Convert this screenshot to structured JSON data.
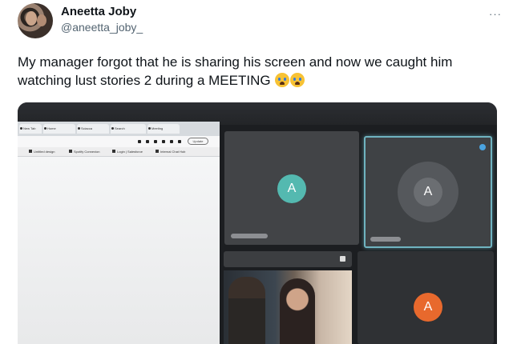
{
  "tweet": {
    "author_name": "Aneetta Joby",
    "author_handle": "@aneetta_joby_",
    "more_menu": "···",
    "text": "My manager forgot that he is sharing his screen and now we caught him watching lust stories 2 during a MEETING"
  },
  "media": {
    "browser": {
      "tabs": [
        "New Tab",
        "Home",
        "Sciacca",
        "Search",
        "Meeting"
      ],
      "update_label": "Update",
      "bookmarks": [
        "Untitled design",
        "Spotify Connexion",
        "Login | Salesforce",
        "Internal Chat Hub"
      ]
    },
    "participants": [
      {
        "initial": "A",
        "color": "#54b9b0"
      },
      {
        "initial": "A",
        "color": "#6b6e72"
      },
      {
        "initial": "A",
        "color": "#e8692d"
      }
    ]
  }
}
